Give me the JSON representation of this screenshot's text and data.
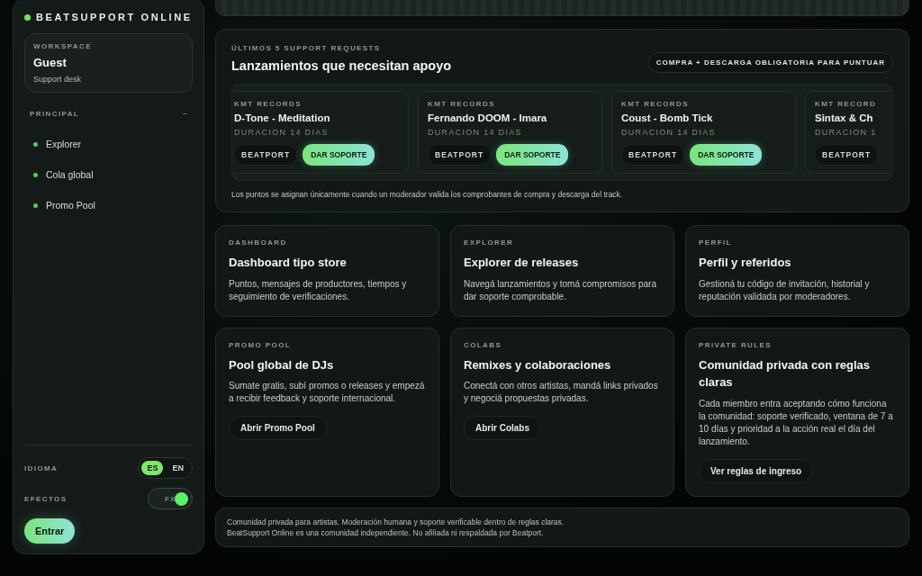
{
  "brand": {
    "name": "BEATSUPPORT ONLINE",
    "online": true
  },
  "workspace": {
    "label": "WORKSPACE",
    "name": "Guest",
    "role": "Support desk"
  },
  "nav": {
    "title": "PRINCIPAL",
    "toggle": "–",
    "items": [
      {
        "label": "Explorer"
      },
      {
        "label": "Cola global"
      },
      {
        "label": "Promo Pool"
      }
    ]
  },
  "language": {
    "label": "IDIOMA",
    "options": [
      {
        "label": "ES",
        "selected": true
      },
      {
        "label": "EN",
        "selected": false
      }
    ]
  },
  "effects": {
    "label": "EFECTOS",
    "switch_label": "FX",
    "on": true
  },
  "login_button": "Entrar",
  "requests": {
    "eyebrow": "ÚLTIMOS 5 SUPPORT REQUESTS",
    "title": "Lanzamientos que necesitan apoyo",
    "badge": "COMPRA + DESCARGA OBLIGATORIA PARA PUNTUAR",
    "releases": [
      {
        "label": "KMT RECORDS",
        "title": "D-Tone - Meditation",
        "duration": "DURACION 14 DIAS",
        "store": "BEATPORT",
        "action": "DAR SOPORTE"
      },
      {
        "label": "KMT RECORDS",
        "title": "Fernando DOOM - Imara",
        "duration": "DURACION 14 DIAS",
        "store": "BEATPORT",
        "action": "DAR SOPORTE"
      },
      {
        "label": "KMT RECORDS",
        "title": "Coust - Bomb Tick",
        "duration": "DURACION 14 DIAS",
        "store": "BEATPORT",
        "action": "DAR SOPORTE"
      },
      {
        "label": "KMT RECORD",
        "title": "Sintax & Ch",
        "duration": "DURACION 1",
        "store": "BEATPORT"
      }
    ],
    "note": "Los puntos se asignan únicamente cuando un moderador valida los comprobantes de compra y descarga del track."
  },
  "cards": [
    {
      "eyebrow": "DASHBOARD",
      "title": "Dashboard tipo store",
      "text": "Puntos, mensajes de productores, tiempos y seguimiento de verificaciones."
    },
    {
      "eyebrow": "EXPLORER",
      "title": "Explorer de releases",
      "text": "Navegá lanzamientos y tomá compromisos para dar soporte comprobable."
    },
    {
      "eyebrow": "PERFIL",
      "title": "Perfil y referidos",
      "text": "Gestioná tu código de invitación, historial y reputación validada por moderadores."
    },
    {
      "eyebrow": "PROMO POOL",
      "title": "Pool global de DJs",
      "text": "Sumate gratis, subí promos o releases y empezá a recibir feedback y soporte internacional.",
      "button": "Abrir Promo Pool"
    },
    {
      "eyebrow": "COLABS",
      "title": "Remixes y colaboraciones",
      "text": "Conectá con otros artistas, mandá links privados y negociá propuestas privadas.",
      "button": "Abrir Colabs"
    },
    {
      "eyebrow": "PRIVATE RULES",
      "title": "Comunidad privada con reglas claras",
      "text": "Cada miembro entra aceptando cómo funciona la comunidad: soporte verificado, ventana de 7 a 10 días y prioridad a la acción real el día del lanzamiento.",
      "button": "Ver reglas de ingreso"
    }
  ],
  "footer": [
    "Comunidad privada para artistas. Moderación humana y soporte verificable dentro de reglas claras.",
    "BeatSupport Online es una comunidad independiente. No afiliada ni respaldada por Beatport."
  ]
}
